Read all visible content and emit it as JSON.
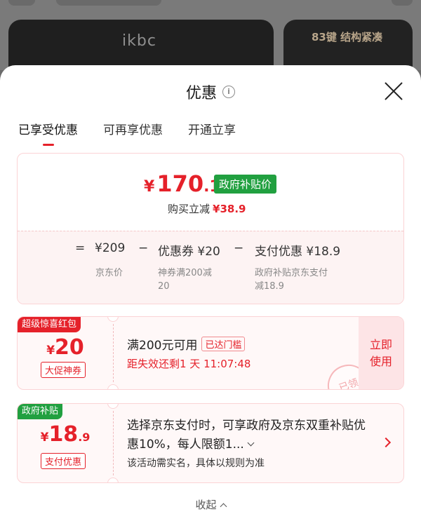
{
  "background": {
    "brand_logo_text": "ikbc",
    "promo_text": "83键 结构紧凑"
  },
  "sheet": {
    "title": "优惠",
    "info_icon": "info-icon",
    "close_icon": "close-icon"
  },
  "tabs": [
    {
      "label": "已享受优惠",
      "active": true
    },
    {
      "label": "可再享优惠",
      "active": false
    },
    {
      "label": "开通立享",
      "active": false
    }
  ],
  "summary": {
    "currency": "¥",
    "final_price_int": "170",
    "final_price_dec": ".1",
    "price_tag": "政府补贴价",
    "buy_reduce_label": "购买立减",
    "buy_reduce_value": "¥38.9",
    "formula": {
      "equals": "=",
      "minus": "−",
      "jd_price": "¥209",
      "jd_price_label": "京东价",
      "coupon": "优惠券 ¥20",
      "coupon_label_1": "神券满200减",
      "coupon_label_2": "20",
      "pay_discount": "支付优惠 ¥18.9",
      "pay_label_1": "政府补贴京东支付",
      "pay_label_2": "减18.9"
    }
  },
  "coupon1": {
    "ribbon": "超级惊喜红包",
    "currency": "¥",
    "amount": "20",
    "tag": "大促神券",
    "condition": "满200元可用",
    "status_badge": "已达门槛",
    "expire": "距失效还剩1 天 11:07:48",
    "action_line1": "立即",
    "action_line2": "使用",
    "stamp": "已领"
  },
  "coupon2": {
    "ribbon": "政府补贴",
    "currency": "¥",
    "amount": "18",
    "amount_dec": ".9",
    "tag": "支付优惠",
    "desc": "选择京东支付时，可享政府及京东双重补贴优惠10%，每人限额1...",
    "note": "该活动需实名，具体以规则为准"
  },
  "footer": {
    "collapse_label": "收起"
  },
  "colors": {
    "accent_red": "#e5212a",
    "gov_green": "#21a040",
    "card_border": "#fbd3d5"
  }
}
